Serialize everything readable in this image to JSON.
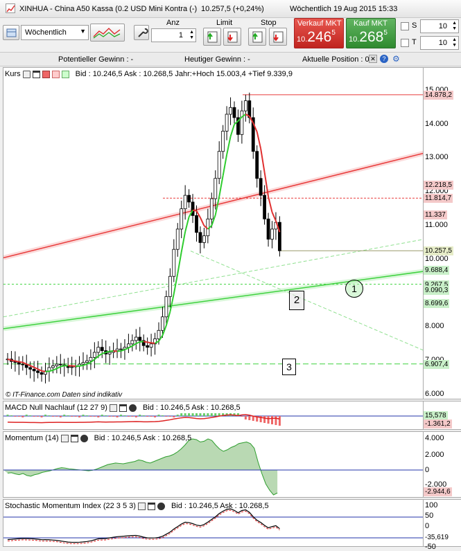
{
  "titlebar": {
    "title": "XINHUA - China A50 Kassa (0.2 USD Mini Kontra (-)",
    "price": "10.257,5 (+0,24%)",
    "datetime": "Wöchentlich  19 Aug 2015 15:33"
  },
  "toolbar": {
    "timeframe": "Wöchentlich",
    "anz_label": "Anz",
    "anz_value": "1",
    "limit_label": "Limit",
    "stop_label": "Stop",
    "sell_label": "Verkauf MKT",
    "sell_prefix": "10.",
    "sell_main": "246",
    "sell_sup": "5",
    "buy_label": "Kauf MKT",
    "buy_prefix": "10.",
    "buy_main": "268",
    "buy_sup": "5",
    "s_label": "S",
    "s_value": "10",
    "t_label": "T",
    "t_value": "10"
  },
  "infobar": {
    "potential_gain": "Potentieller Gewinn : -",
    "today_gain": "Heutiger Gewinn : -",
    "current_position": "Aktuelle Position : 0"
  },
  "main_panel": {
    "name": "Kurs",
    "info": "Bid : 10.246,5 Ask : 10.268,5 Jahr:+Hoch 15.003,4 +Tief 9.339,9",
    "copyright": "© IT-Finance.com  Daten sind indikativ",
    "y_ticks": [
      "15.000",
      "14.000",
      "13.000",
      "12.000",
      "11.000",
      "10.000",
      "9.000",
      "8.000",
      "7.000",
      "6.000"
    ],
    "tags": [
      {
        "text": "14.878,2",
        "value": 14878.2,
        "bg": "#f4c9c9"
      },
      {
        "text": "12.218,5",
        "value": 12218.5,
        "bg": "#f4c9c9"
      },
      {
        "text": "11.814,7",
        "value": 11814.7,
        "bg": "#f4c9c9"
      },
      {
        "text": "11.337",
        "value": 11337,
        "bg": "#f4c9c9"
      },
      {
        "text": "10.257,5",
        "value": 10257.5,
        "bg": "#e6ecc8"
      },
      {
        "text": "9.688,4",
        "value": 9688.4,
        "bg": "#c9f0c9"
      },
      {
        "text": "9.267,5",
        "value": 9267.5,
        "bg": "#c9f0c9"
      },
      {
        "text": "9.090,3",
        "value": 9090.3,
        "bg": "#c9f0c9"
      },
      {
        "text": "8.699,6",
        "value": 8699.6,
        "bg": "#c9f0c9"
      },
      {
        "text": "6.907,4",
        "value": 6907.4,
        "bg": "#c9f0c9"
      }
    ],
    "markers": [
      "1",
      "2",
      "3"
    ]
  },
  "macd_panel": {
    "name": "MACD Null Nachlauf (12 27 9)",
    "info": "Bid : 10.246,5 Ask : 10.268,5",
    "tags": [
      {
        "text": "15,578",
        "bg": "#c9f0c9"
      },
      {
        "text": "-1.361,2",
        "bg": "#f4c9c9"
      }
    ]
  },
  "momentum_panel": {
    "name": "Momentum (14)",
    "info": "Bid : 10.246,5 Ask : 10.268,5",
    "y_ticks": [
      "4.000",
      "2.000",
      "0",
      "-2.000"
    ],
    "tags": [
      {
        "text": "-2.944,6",
        "bg": "#f4c9c9"
      }
    ]
  },
  "smi_panel": {
    "name": "Stochastic Momentum Index (22 3 5 3)",
    "info": "Bid : 10.246,5 Ask : 10.268,5",
    "y_ticks": [
      "100",
      "50",
      "0",
      "-50"
    ],
    "tags": [
      {
        "text": "-35,619",
        "bg": "#ffffff"
      }
    ]
  },
  "colors": {
    "sell": "#d9332f",
    "buy": "#3f9e3f",
    "bull": "#2ecc2e",
    "bear": "#e03030"
  },
  "chart_data": {
    "type": "candlestick",
    "title": "XINHUA - China A50 Kassa",
    "timeframe": "weekly",
    "ylim": [
      6000,
      15100
    ],
    "last": 10257.5,
    "year_high": 15003.4,
    "year_low": 9339.9,
    "close_series": [
      7050,
      6980,
      6950,
      6900,
      6880,
      6800,
      6750,
      6700,
      6650,
      6600,
      6700,
      6800,
      6850,
      6900,
      6880,
      6850,
      6800,
      6820,
      6850,
      6900,
      6950,
      7000,
      7100,
      7250,
      7400,
      7300,
      7200,
      7250,
      7300,
      7350,
      7350,
      7400,
      7500,
      7600,
      7700,
      7600,
      7450,
      7400,
      7500,
      7650,
      7900,
      8300,
      8900,
      9500,
      10300,
      10900,
      11500,
      11900,
      11700,
      11300,
      10800,
      10500,
      10700,
      11200,
      11800,
      12400,
      13200,
      13800,
      14300,
      14500,
      14200,
      13700,
      14400,
      14700,
      14200,
      13200,
      12400,
      11900,
      11200,
      10600,
      10900,
      11100,
      10257.5
    ],
    "momentum_series": [
      -400,
      -350,
      -500,
      -600,
      -450,
      -700,
      -800,
      -600,
      -500,
      -300,
      -200,
      -100,
      50,
      200,
      300,
      250,
      150,
      100,
      50,
      0,
      -50,
      -100,
      -30,
      100,
      300,
      500,
      700,
      800,
      900,
      850,
      800,
      900,
      1000,
      1100,
      1300,
      1200,
      1000,
      900,
      1100,
      1300,
      1500,
      1700,
      1800,
      2000,
      2300,
      2700,
      3200,
      3800,
      4000,
      3900,
      3600,
      3700,
      4000,
      3800,
      3200,
      2700,
      2400,
      2600,
      2900,
      3100,
      3400,
      3500,
      3600,
      3400,
      2800,
      1000,
      -500,
      -1800,
      -2600,
      -3200,
      -2944.6
    ],
    "momentum_ylim": [
      -3500,
      4500
    ]
  }
}
